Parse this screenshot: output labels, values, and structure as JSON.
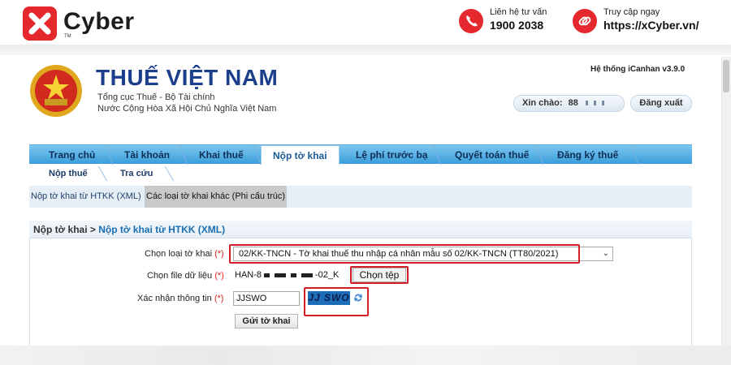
{
  "banner": {
    "brand": "Cyber",
    "brand_tm": "TM",
    "hotline_label": "Liên hệ tư vấn",
    "hotline_number": "1900 2038",
    "web_label": "Truy cập ngay",
    "web_url": "https://xCyber.vn/",
    "accent_color": "#e5282e"
  },
  "site": {
    "title": "THUẾ VIỆT NAM",
    "subtitle1": "Tổng cục Thuế - Bộ Tài chính",
    "subtitle2": "Nước Cộng Hòa Xã Hội Chủ Nghĩa Việt Nam",
    "system_version": "Hệ thống iCanhan v3.9.0",
    "greeting": "Xin chào:",
    "user_masked": "88",
    "logout": "Đăng xuất"
  },
  "main_nav": [
    "Trang chủ",
    "Tài khoản",
    "Khai thuế",
    "Nộp tờ khai",
    "Lệ phí trước bạ",
    "Quyết toán thuế",
    "Đăng ký thuế"
  ],
  "main_nav_active": "Nộp tờ khai",
  "sub_nav": [
    "Nộp thuế",
    "Tra cứu"
  ],
  "sub_tabs": [
    "Nộp tờ khai từ HTKK (XML)",
    "Các loại tờ khai khác (Phi cấu trúc)"
  ],
  "sub_tabs_active": "Các loại tờ khai khác (Phi cấu trúc)",
  "breadcrumb": {
    "parent": "Nộp tờ khai",
    "separator": ">",
    "current": "Nộp tờ khai từ HTKK (XML)"
  },
  "form": {
    "required_mark": "(*)",
    "declaration_label": "Chọn loại tờ khai",
    "declaration_value": "02/KK-TNCN - Tờ khai thuế thu nhập cá nhân mẫu số 02/KK-TNCN (TT80/2021)",
    "file_label": "Chọn file dữ liệu",
    "file_prefix": "HAN-8",
    "file_suffix": "-02_K",
    "choose_file_button": "Chọn tệp",
    "captcha_label": "Xác nhận thông tin",
    "captcha_value": "JJSWO",
    "captcha_image_text": "JJ SWO",
    "submit_button": "Gửi tờ khai"
  }
}
